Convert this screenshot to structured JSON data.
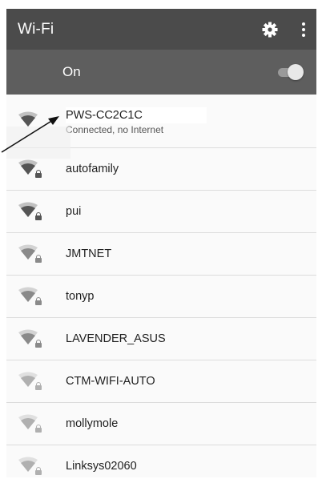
{
  "header": {
    "title": "Wi-Fi",
    "settings_icon": "gear-icon",
    "more_icon": "more-vert-icon"
  },
  "toggle": {
    "label": "On",
    "state": "on"
  },
  "networks": [
    {
      "name": "PWS-CC2C1C",
      "status": "Connected, no Internet",
      "level": "full",
      "secured": false
    },
    {
      "name": "autofamily",
      "level": "full",
      "secured": true
    },
    {
      "name": "pui",
      "level": "full",
      "secured": true
    },
    {
      "name": "JMTNET",
      "level": "medium",
      "secured": true
    },
    {
      "name": "tonyp",
      "level": "medium",
      "secured": true
    },
    {
      "name": "LAVENDER_ASUS",
      "level": "medium",
      "secured": true
    },
    {
      "name": "CTM-WIFI-AUTO",
      "level": "low",
      "secured": true
    },
    {
      "name": "mollymole",
      "level": "low",
      "secured": true
    },
    {
      "name": "Linksys02060",
      "level": "low",
      "secured": true
    }
  ],
  "colors": {
    "toolbar": "#4b4b4b",
    "toggle_bar": "#5e5e5e"
  }
}
